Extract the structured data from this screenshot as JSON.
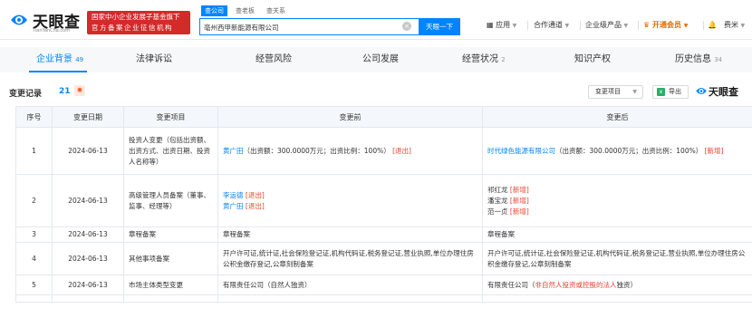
{
  "header": {
    "logo_text": "天眼查",
    "logo_url": "TianYanCha.com",
    "promo_line1": "国家中小企业发展子基金旗下",
    "promo_line2": "官方备案企业征信机构",
    "search_tabs": [
      "查公司",
      "查老板",
      "查关系"
    ],
    "search_value": "亳州西甲新能源有限公司",
    "search_button": "天眼一下",
    "nav": {
      "app": "应用",
      "partner": "合作通道",
      "enterprise": "企业级产品",
      "vip": "开通会员",
      "user": "费米"
    }
  },
  "tabs": [
    {
      "label": "企业背景",
      "count": "49"
    },
    {
      "label": "法律诉讼",
      "count": ""
    },
    {
      "label": "经营风险",
      "count": ""
    },
    {
      "label": "公司发展",
      "count": ""
    },
    {
      "label": "经营状况",
      "count": "2"
    },
    {
      "label": "知识产权",
      "count": ""
    },
    {
      "label": "历史信息",
      "count": "34"
    }
  ],
  "section": {
    "title": "变更记录",
    "count": "21",
    "filter": "变更项目",
    "export": "导出",
    "watermark": "天眼查"
  },
  "table": {
    "headers": [
      "序号",
      "变更日期",
      "变更项目",
      "变更前",
      "变更后"
    ],
    "rows": [
      {
        "no": "1",
        "date": "2024-06-13",
        "item": "投资人变更（包括出资额、出资方式、出资日期、投资人名称等）",
        "before_name": "黄广田",
        "before_text": "（出资额：300.0000万元；出资比例：100%）",
        "before_tag": "[退出]",
        "after_name": "时代绿色能源有限公司",
        "after_text": "（出资额：300.0000万元；出资比例：100%）",
        "after_tag": "[新增]"
      },
      {
        "no": "2",
        "date": "2024-06-13",
        "item": "高级管理人员备案（董事、监事、经理等）",
        "before": [
          {
            "name": "李运德",
            "tag": "[退出]"
          },
          {
            "name": "黄广田",
            "tag": "[退出]"
          }
        ],
        "after": [
          {
            "name": "祁红龙",
            "tag": "[新增]"
          },
          {
            "name": "潘宝龙",
            "tag": "[新增]"
          },
          {
            "name": "范一贞",
            "tag": "[新增]"
          }
        ]
      },
      {
        "no": "3",
        "date": "2024-06-13",
        "item": "章程备案",
        "before": "章程备案",
        "after": "章程备案"
      },
      {
        "no": "4",
        "date": "2024-06-13",
        "item": "其他事项备案",
        "before": "开户许可证,统计证,社会保险登记证,机构代码证,税务登记证,营业执照,单位办理住房公积金缴存登记,公章刻制备案",
        "after": "开户许可证,统计证,社会保险登记证,机构代码证,税务登记证,营业执照,单位办理住房公积金缴存登记,公章刻制备案"
      },
      {
        "no": "5",
        "date": "2024-06-13",
        "item": "市场主体类型变更",
        "before": "有限责任公司（自然人独资）",
        "after_prefix": "有限责任公司（",
        "after_red": "非自然人投资或控股的法人",
        "after_suffix": "独资）"
      }
    ]
  },
  "colors": {
    "accent": "#0084ff",
    "promo": "#d32a2a",
    "tag_red": "#e8412e",
    "vip": "#e06b00"
  }
}
